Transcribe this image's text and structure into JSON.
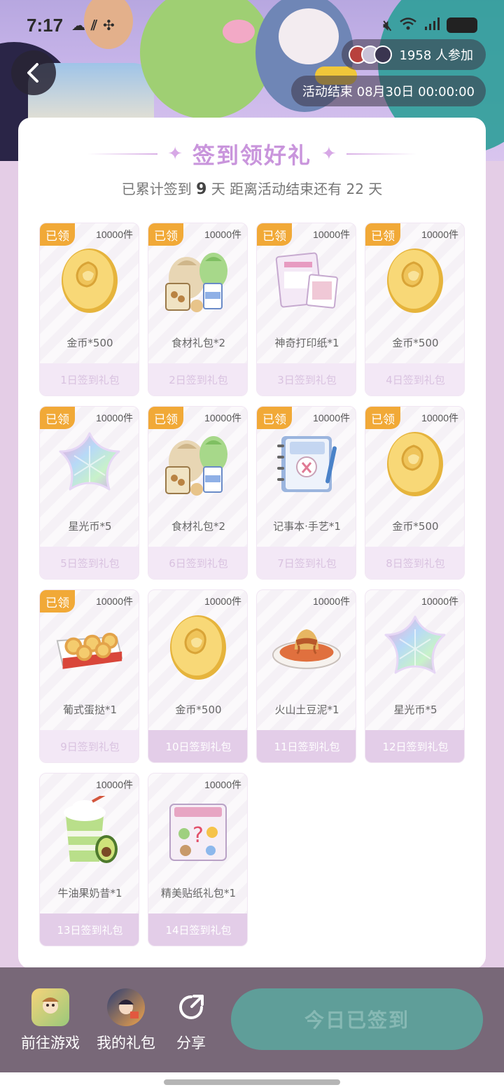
{
  "status_bar": {
    "time": "7:17",
    "battery_color": "#222222"
  },
  "header": {
    "participants_count": "1958 人参加",
    "end_time": "活动结束 08月30日 00:00:00"
  },
  "card": {
    "title": "签到领好礼",
    "subtitle_prefix": "已累计签到",
    "signed_days": "9",
    "subtitle_mid": "天  距离活动结束还有 22 天"
  },
  "claimed_tag": "已领",
  "rewards": [
    {
      "stock": "10000件",
      "name": "金币*500",
      "day": "1日签到礼包",
      "icon": "gold-coin-icon",
      "claimed": true
    },
    {
      "stock": "10000件",
      "name": "食材礼包*2",
      "day": "2日签到礼包",
      "icon": "ingredient-pack-icon",
      "claimed": true
    },
    {
      "stock": "10000件",
      "name": "神奇打印纸*1",
      "day": "3日签到礼包",
      "icon": "print-paper-icon",
      "claimed": true
    },
    {
      "stock": "10000件",
      "name": "金币*500",
      "day": "4日签到礼包",
      "icon": "gold-coin-icon",
      "claimed": true
    },
    {
      "stock": "10000件",
      "name": "星光币*5",
      "day": "5日签到礼包",
      "icon": "starlight-coin-icon",
      "claimed": true
    },
    {
      "stock": "10000件",
      "name": "食材礼包*2",
      "day": "6日签到礼包",
      "icon": "ingredient-pack-icon",
      "claimed": true
    },
    {
      "stock": "10000件",
      "name": "记事本·手艺*1",
      "day": "7日签到礼包",
      "icon": "notebook-icon",
      "claimed": true
    },
    {
      "stock": "10000件",
      "name": "金币*500",
      "day": "8日签到礼包",
      "icon": "gold-coin-icon",
      "claimed": true
    },
    {
      "stock": "10000件",
      "name": "葡式蛋挞*1",
      "day": "9日签到礼包",
      "icon": "egg-tart-icon",
      "claimed": true
    },
    {
      "stock": "10000件",
      "name": "金币*500",
      "day": "10日签到礼包",
      "icon": "gold-coin-icon",
      "claimed": false
    },
    {
      "stock": "10000件",
      "name": "火山土豆泥*1",
      "day": "11日签到礼包",
      "icon": "mashed-potato-icon",
      "claimed": false
    },
    {
      "stock": "10000件",
      "name": "星光币*5",
      "day": "12日签到礼包",
      "icon": "starlight-coin-icon",
      "claimed": false
    },
    {
      "stock": "10000件",
      "name": "牛油果奶昔*1",
      "day": "13日签到礼包",
      "icon": "avocado-shake-icon",
      "claimed": false
    },
    {
      "stock": "10000件",
      "name": "精美贴纸礼包*1",
      "day": "14日签到礼包",
      "icon": "sticker-pack-icon",
      "claimed": false
    }
  ],
  "bottom_bar": {
    "go_game": "前往游戏",
    "my_gifts": "我的礼包",
    "share": "分享",
    "signed_button": "今日已签到"
  },
  "colors": {
    "claimed_tag": "#f1a937",
    "title": "#c995dc",
    "signed_button": "#5f9e99",
    "bottom_bar": "#786878"
  }
}
